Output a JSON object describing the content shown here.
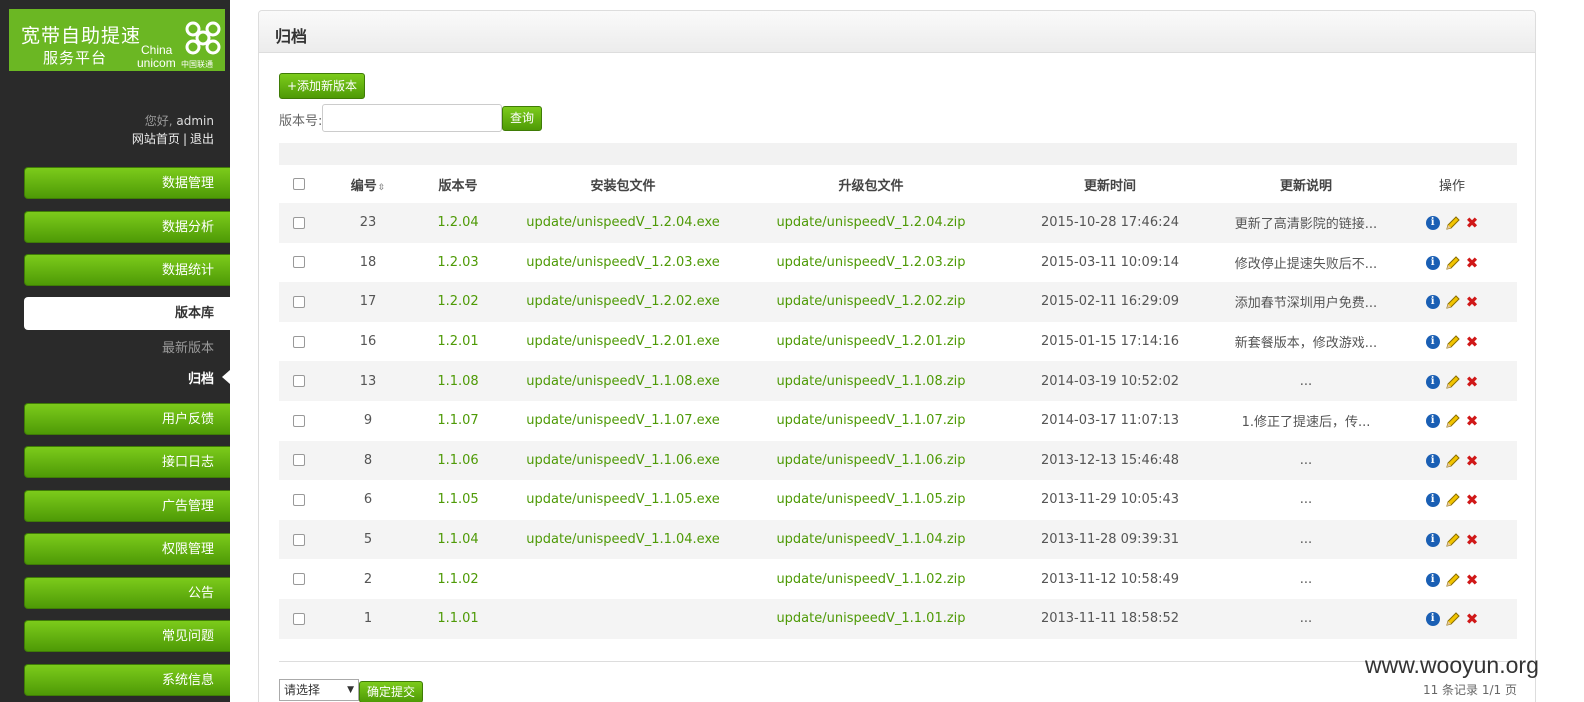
{
  "logo": {
    "line1": "宽带自助提速",
    "line2": "服务平台",
    "brand_en1": "China",
    "brand_en2": "unicom",
    "brand_cn": "中国联通"
  },
  "user": {
    "greeting": "您好,",
    "username": "admin",
    "home_link": "网站首页",
    "separator": "|",
    "logout_link": "退出"
  },
  "sidebar": {
    "items_top": [
      "数据管理",
      "数据分析",
      "数据统计"
    ],
    "active": "版本库",
    "sub": [
      "最新版本",
      "归档"
    ],
    "items_bottom": [
      "用户反馈",
      "接口日志",
      "广告管理",
      "权限管理",
      "公告",
      "常见问题",
      "系统信息"
    ]
  },
  "panel": {
    "title": "归档",
    "add_button": "+添加新版本",
    "search_label": "版本号:",
    "search_value": "",
    "search_button": "查询"
  },
  "table": {
    "headers": [
      "编号",
      "版本号",
      "安装包文件",
      "升级包文件",
      "更新时间",
      "更新说明",
      "操作"
    ],
    "rows": [
      {
        "id": "23",
        "version": "1.2.04",
        "exe": "update/unispeedV_1.2.04.exe",
        "zip": "update/unispeedV_1.2.04.zip",
        "time": "2015-10-28 17:46:24",
        "note": "更新了高清影院的链接..."
      },
      {
        "id": "18",
        "version": "1.2.03",
        "exe": "update/unispeedV_1.2.03.exe",
        "zip": "update/unispeedV_1.2.03.zip",
        "time": "2015-03-11 10:09:14",
        "note": "修改停止提速失败后不..."
      },
      {
        "id": "17",
        "version": "1.2.02",
        "exe": "update/unispeedV_1.2.02.exe",
        "zip": "update/unispeedV_1.2.02.zip",
        "time": "2015-02-11 16:29:09",
        "note": "添加春节深圳用户免费..."
      },
      {
        "id": "16",
        "version": "1.2.01",
        "exe": "update/unispeedV_1.2.01.exe",
        "zip": "update/unispeedV_1.2.01.zip",
        "time": "2015-01-15 17:14:16",
        "note": "新套餐版本，修改游戏..."
      },
      {
        "id": "13",
        "version": "1.1.08",
        "exe": "update/unispeedV_1.1.08.exe",
        "zip": "update/unispeedV_1.1.08.zip",
        "time": "2014-03-19 10:52:02",
        "note": "..."
      },
      {
        "id": "9",
        "version": "1.1.07",
        "exe": "update/unispeedV_1.1.07.exe",
        "zip": "update/unispeedV_1.1.07.zip",
        "time": "2014-03-17 11:07:13",
        "note": "1.修正了提速后，传..."
      },
      {
        "id": "8",
        "version": "1.1.06",
        "exe": "update/unispeedV_1.1.06.exe",
        "zip": "update/unispeedV_1.1.06.zip",
        "time": "2013-12-13 15:46:48",
        "note": "..."
      },
      {
        "id": "6",
        "version": "1.1.05",
        "exe": "update/unispeedV_1.1.05.exe",
        "zip": "update/unispeedV_1.1.05.zip",
        "time": "2013-11-29 10:05:43",
        "note": "..."
      },
      {
        "id": "5",
        "version": "1.1.04",
        "exe": "update/unispeedV_1.1.04.exe",
        "zip": "update/unispeedV_1.1.04.zip",
        "time": "2013-11-28 09:39:31",
        "note": "..."
      },
      {
        "id": "2",
        "version": "1.1.02",
        "exe": "",
        "zip": "update/unispeedV_1.1.02.zip",
        "time": "2013-11-12 10:58:49",
        "note": "..."
      },
      {
        "id": "1",
        "version": "1.1.01",
        "exe": "",
        "zip": "update/unispeedV_1.1.01.zip",
        "time": "2013-11-11 18:58:52",
        "note": "..."
      }
    ]
  },
  "footer": {
    "select_value": "请选择",
    "submit_button": "确定提交",
    "pager": "11 条记录 1/1 页"
  },
  "watermark": "www.wooyun.org",
  "icons": {
    "sort": "sort-icon",
    "info": "info-icon",
    "edit": "pencil-icon",
    "delete": "delete-x-icon"
  },
  "colors": {
    "brand_green": "#6bb723",
    "link_green": "#4e9a06",
    "sidebar_bg": "#2a2a2a",
    "delete_red": "#d01818",
    "info_blue": "#1a5fb4"
  }
}
